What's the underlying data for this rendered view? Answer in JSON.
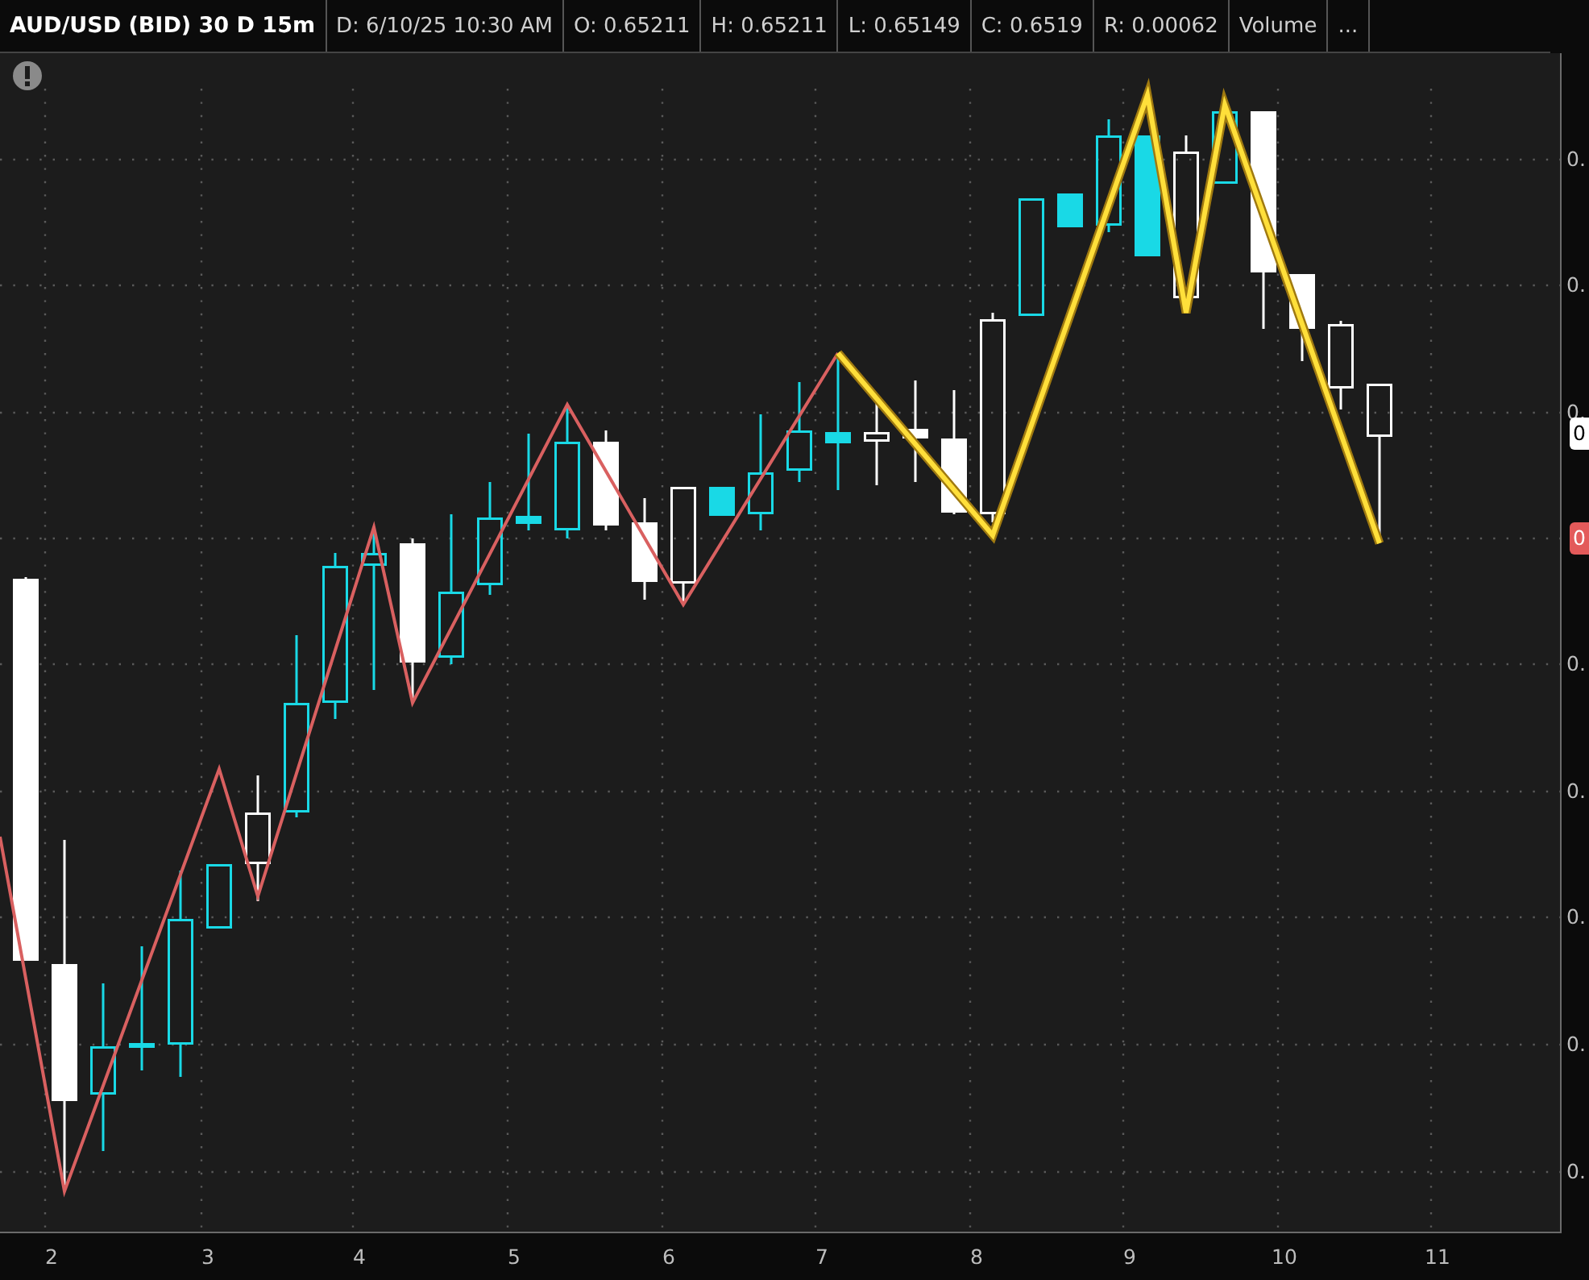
{
  "header": {
    "symbol": "AUD/USD (BID) 30 D 15m",
    "fields": [
      "D: 6/10/25 10:30 AM",
      "O: 0.65211",
      "H: 0.65211",
      "L: 0.65149",
      "C: 0.6519",
      "R: 0.00062",
      "Volume",
      "..."
    ]
  },
  "chart": {
    "y_axis_labels": [
      "0.",
      "0.",
      "0.",
      "0.",
      "0.",
      "0.",
      "0.",
      "0."
    ],
    "price_tags": [
      {
        "text": "0",
        "color": "#ffffff"
      },
      {
        "text": "0",
        "color": "#e35a5a"
      }
    ],
    "x_axis_labels": [
      "2",
      "3",
      "4",
      "5",
      "6",
      "7",
      "8",
      "9",
      "10",
      "11"
    ]
  }
}
